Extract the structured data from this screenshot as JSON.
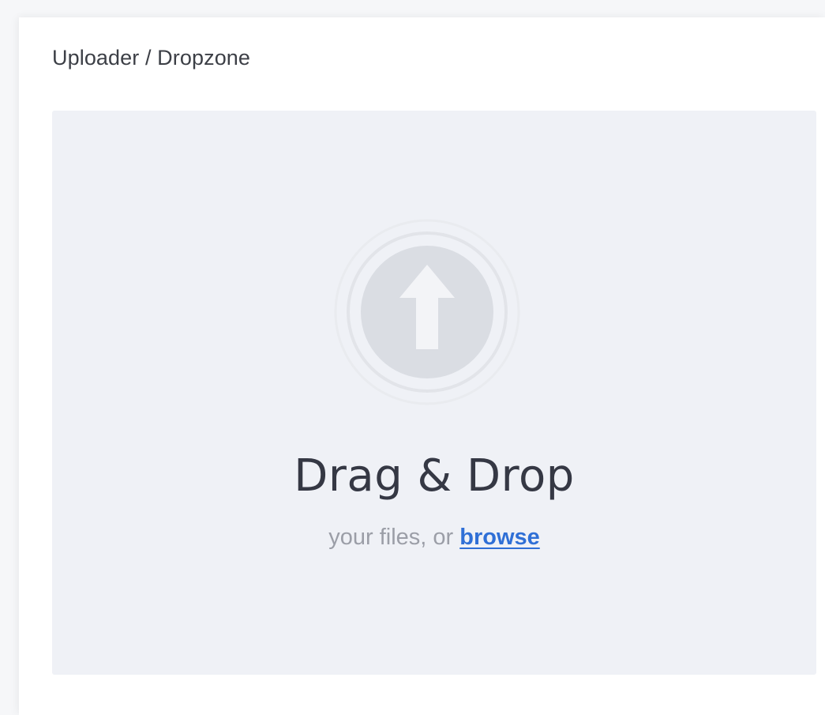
{
  "panel": {
    "title": "Uploader / Dropzone"
  },
  "dropzone": {
    "icon": "upload-arrow-icon",
    "headline": "Drag & Drop",
    "prompt_prefix": "your files, or ",
    "browse_label": "browse"
  },
  "colors": {
    "page_background": "#f6f7f9",
    "panel_background": "#ffffff",
    "dropzone_background": "#eff1f6",
    "icon_ring": "#e4e6eb",
    "icon_fill": "#dadde3",
    "arrow": "#f3f4f7",
    "headline_text": "#353844",
    "muted_text": "#9b9ea7",
    "link": "#2f6fd6"
  }
}
